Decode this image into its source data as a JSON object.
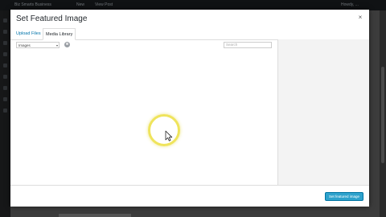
{
  "admin_bar": {
    "site_name": "Biz Smarts Business",
    "new_label": "New",
    "view_post": "View Post",
    "account": "Howdy, ..."
  },
  "modal": {
    "title": "Set Featured Image",
    "close_glyph": "×",
    "tabs": [
      {
        "label": "Upload Files",
        "active": false
      },
      {
        "label": "Media Library",
        "active": true
      }
    ]
  },
  "toolbar": {
    "filter_value": "Images",
    "search_placeholder": "Search"
  },
  "footer": {
    "primary_button": "Set featured image"
  },
  "colors": {
    "primary": "#2ea2cc",
    "highlight_ring": "#efe45c"
  },
  "icons": {
    "spinner": "spinner-icon",
    "cursor": "cursor-arrow-icon",
    "close": "close-icon"
  }
}
